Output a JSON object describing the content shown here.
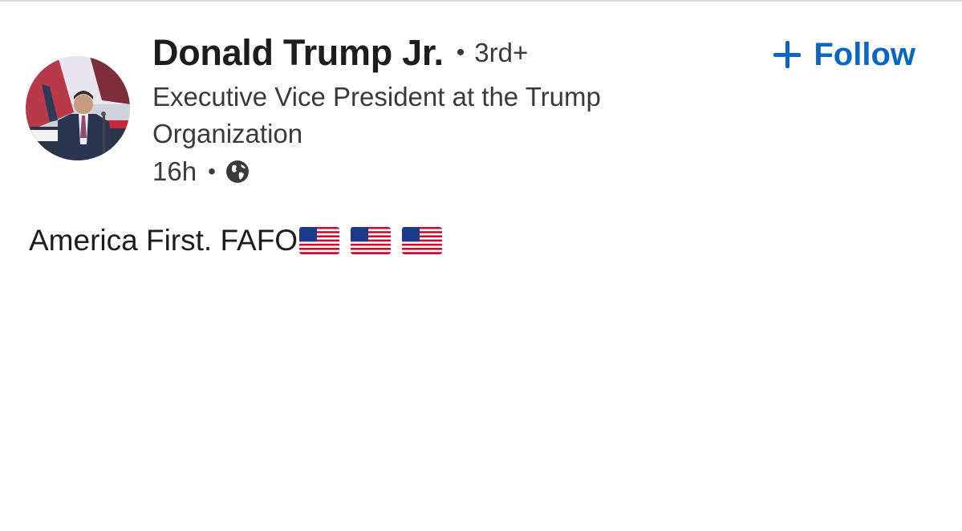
{
  "post": {
    "author": {
      "name": "Donald Trump Jr.",
      "connection_degree": "3rd+",
      "headline": "Executive Vice President at the Trump Organization",
      "avatar_icon": "profile-photo"
    },
    "timestamp": "16h",
    "separator": "•",
    "visibility_icon": "globe-icon",
    "follow": {
      "label": "Follow",
      "icon": "plus-icon",
      "color": "#0a66c2"
    },
    "body": {
      "text": "America First. FAFO",
      "emojis": [
        "us-flag",
        "us-flag",
        "us-flag"
      ]
    }
  }
}
